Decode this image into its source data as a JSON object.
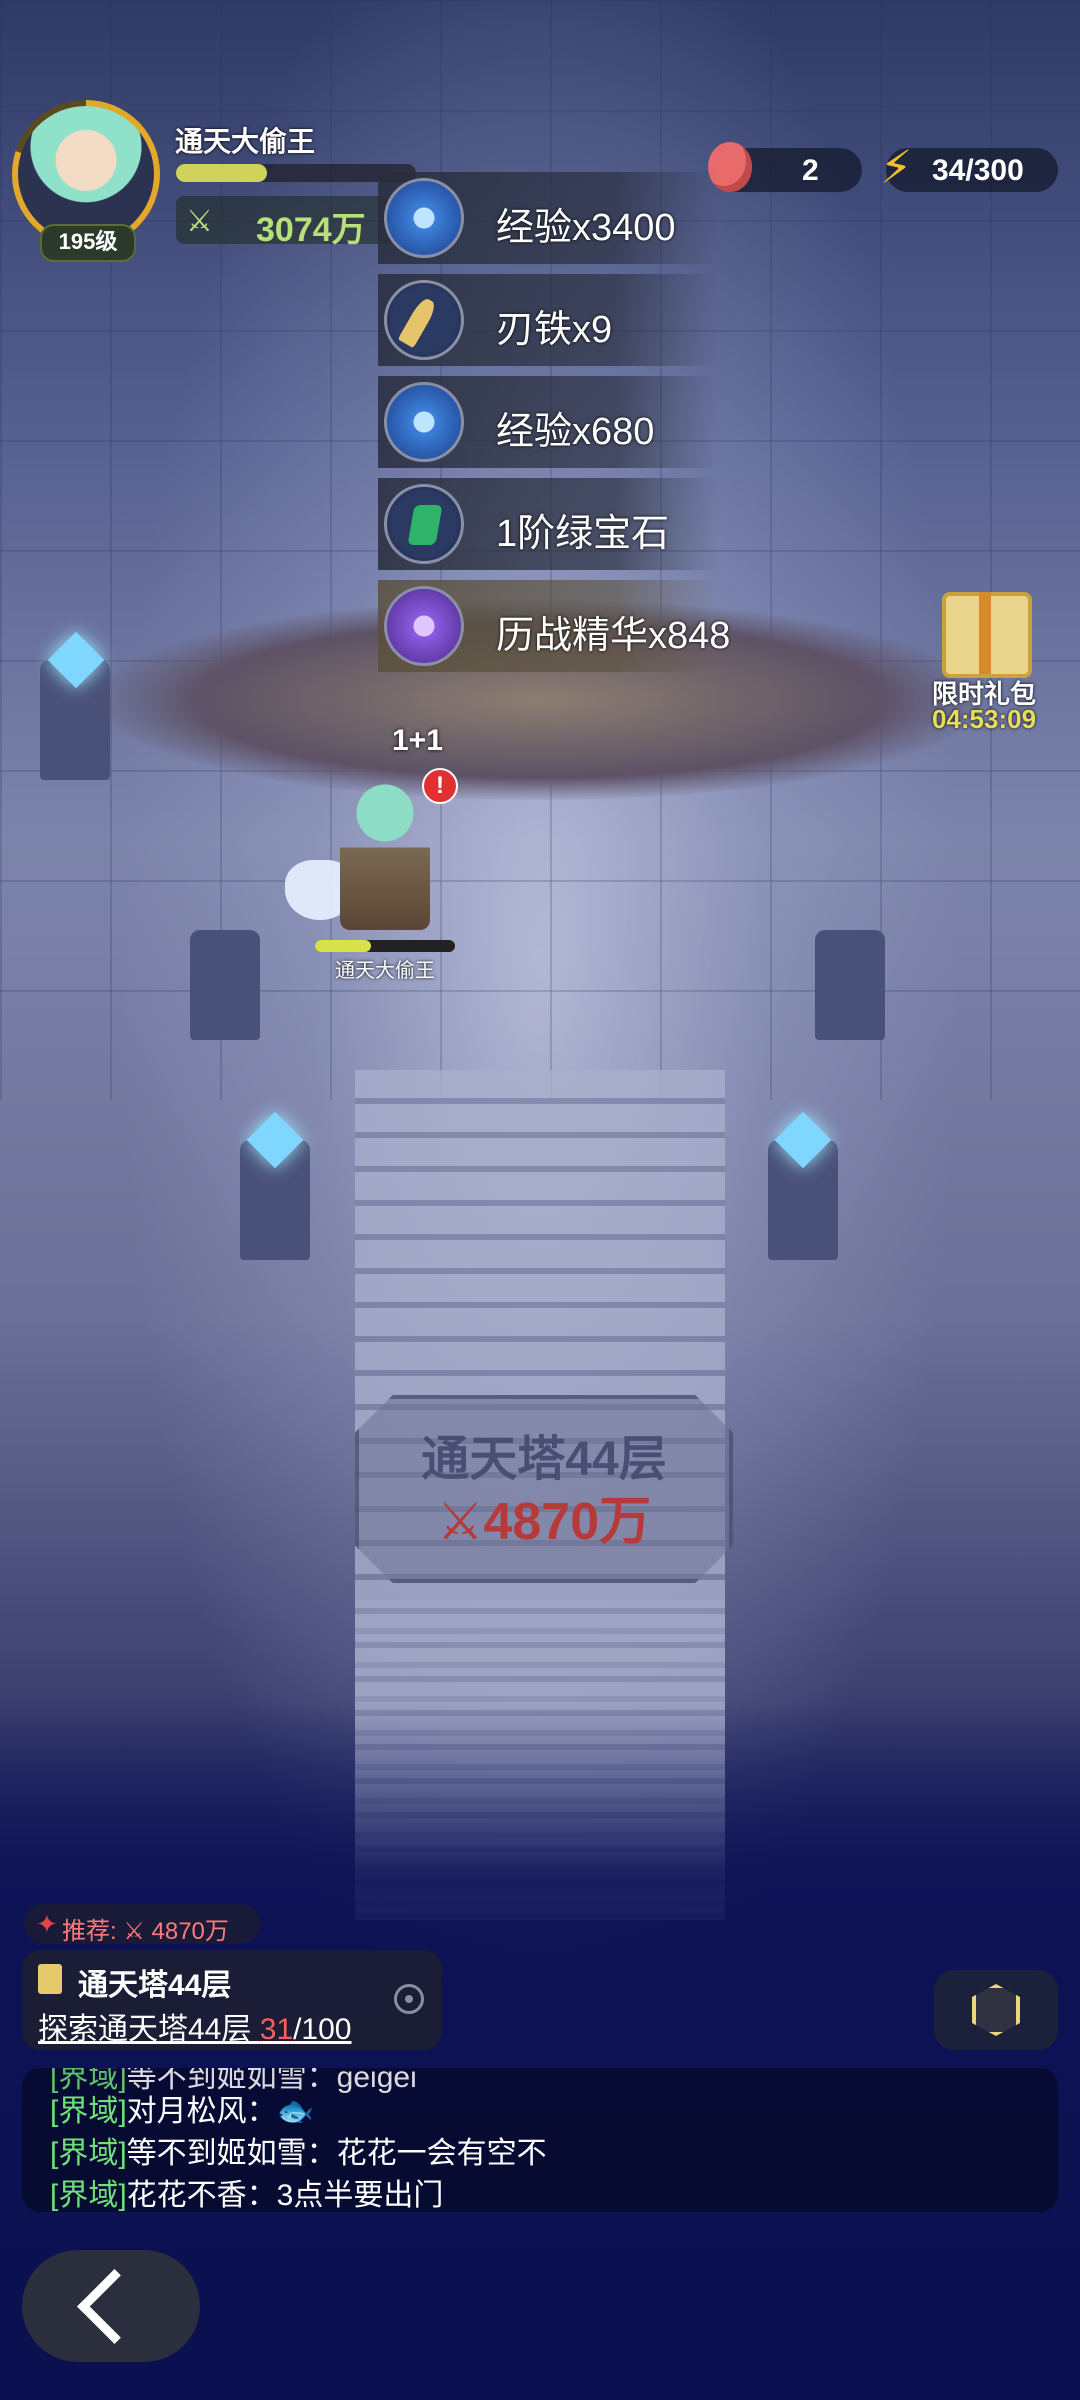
{
  "player": {
    "name": "通天大偷王",
    "level": "195级",
    "power_icon": "crossed-swords-icon",
    "power": "3074万",
    "exp_fill_fraction": 0.38
  },
  "resources": {
    "peach": {
      "icon": "peach-icon",
      "value": "2"
    },
    "energy": {
      "icon": "lightning-icon",
      "value": "34/300"
    }
  },
  "rewards": [
    {
      "icon": "exp-orb-icon",
      "label": "经验x3400"
    },
    {
      "icon": "blade-iron-icon",
      "label": "刃铁x9"
    },
    {
      "icon": "exp-orb-icon",
      "label": "经验x680"
    },
    {
      "icon": "green-gem-icon",
      "label": "1阶绿宝石"
    },
    {
      "icon": "battle-essence-icon",
      "label": "历战精华x848"
    }
  ],
  "gift": {
    "title": "限时礼包",
    "timer": "04:53:09"
  },
  "battle": {
    "drop_text": "1+1",
    "alert": "!",
    "hero_name": "通天大偷王",
    "hero_hp_fraction": 0.4
  },
  "tower": {
    "floor": "通天塔44层",
    "power": "4870万",
    "power_icon": "crossed-swords-icon"
  },
  "recommend": {
    "text": "推荐: ⚔ 4870万"
  },
  "quest": {
    "title": "通天塔44层",
    "desc_prefix": "探索通天塔44层 ",
    "current": "31",
    "total": "/100"
  },
  "chat": {
    "cut_line": {
      "channel": "[界域]",
      "text": "等不到姬如雪：geigei"
    },
    "lines": [
      {
        "channel": "[界域]",
        "text": "对月松风：🐟"
      },
      {
        "channel": "[界域]",
        "text": "等不到姬如雪：花花一会有空不"
      },
      {
        "channel": "[界域]",
        "text": "花花不香：3点半要出门"
      }
    ]
  },
  "colors": {
    "power_green": "#b7e07a",
    "tower_red": "#b73a3a",
    "chat_channel": "#6fe07a",
    "gift_timer": "#e7dd5a",
    "quest_current": "#ff5d5d"
  }
}
